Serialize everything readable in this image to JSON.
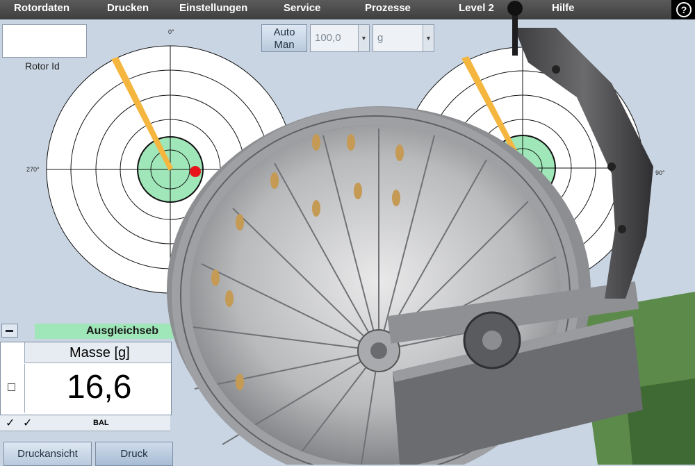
{
  "menu": {
    "items": [
      "Rotordaten",
      "Drucken",
      "Einstellungen",
      "Service",
      "Prozesse",
      "Level 2",
      "Hilfe"
    ],
    "help_glyph": "?"
  },
  "rotor": {
    "id_label": "Rotor Id",
    "id_value": ""
  },
  "controls": {
    "auto_label": "Auto",
    "man_label": "Man",
    "tolerance_value": "100,0",
    "unit_value": "g"
  },
  "polar": {
    "left": {
      "top_label": "0°",
      "left_label": "270°"
    },
    "right": {
      "right_label": "90°"
    }
  },
  "correction": {
    "title": "Ausgleichseb"
  },
  "mass": {
    "header": "Masse [g]",
    "value": "16,6"
  },
  "status": {
    "check1": "✓",
    "check2": "✓",
    "bal": "BAL"
  },
  "buttons": {
    "print_preview": "Druckansicht",
    "print": "Druck"
  },
  "colors": {
    "tolerance_zone": "#9fe6b8",
    "needle": "#f5b640",
    "marker": "#e8141c",
    "menubar": "#474747"
  }
}
